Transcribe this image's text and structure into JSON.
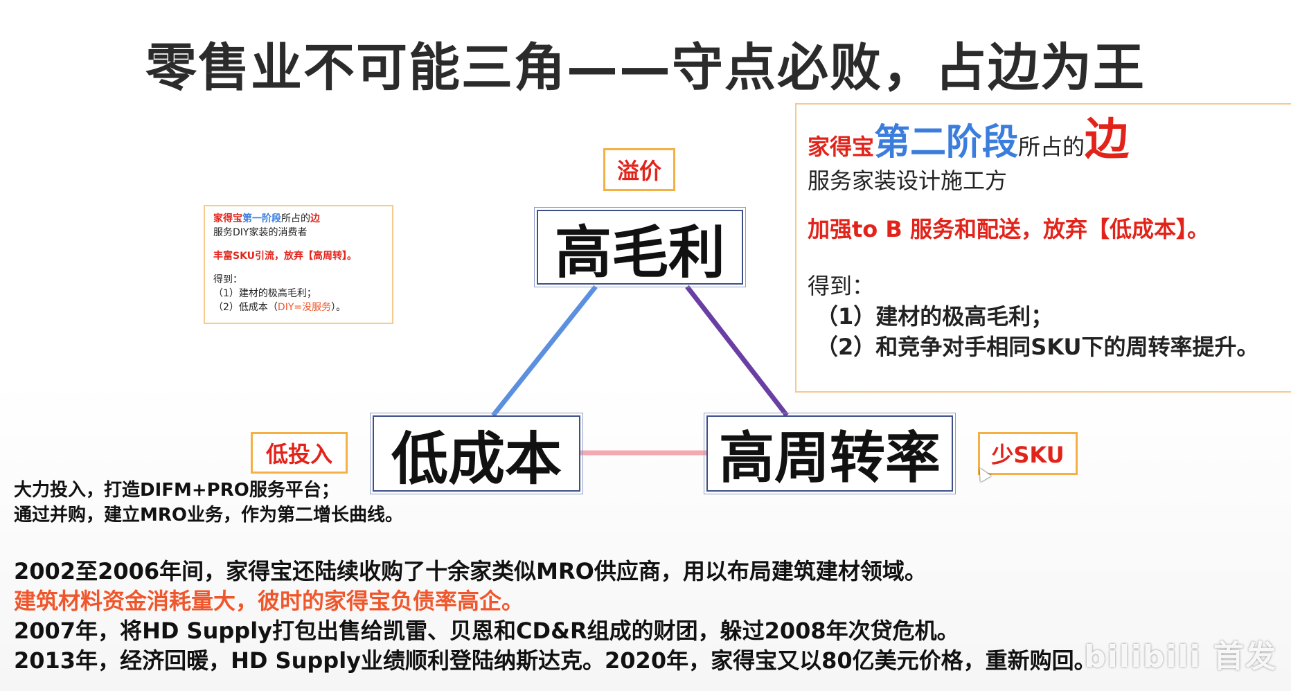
{
  "slide": {
    "title": "零售业不可能三角——守点必败，占边为王",
    "nodes": {
      "top": "高毛利",
      "left": "低成本",
      "right": "高周转率"
    },
    "tags": {
      "premium": "溢价",
      "low_investment": "低投入",
      "less_sku": "少SKU"
    },
    "colors": {
      "edge_top_left": "#5b8fe0",
      "edge_top_right": "#6a3fa3",
      "edge_left_right": "#f2a9b0"
    },
    "stage1_card": {
      "line1_a": "家得宝",
      "line1_b": "第一阶段",
      "line1_c": "所占的",
      "line1_d": "边",
      "line2": "服务DIY家装的消费者",
      "line3": "丰富SKU引流，放弃【高周转】。",
      "got_label": "得到：",
      "item1": "（1）建材的极高毛利；",
      "item2_a": "（2）低成本（",
      "item2_b": "DIY=没服务",
      "item2_c": "）。"
    },
    "stage2_card": {
      "head_a": "家得宝",
      "head_b": "第二阶段",
      "head_c": "所占的",
      "head_d": "边",
      "line2": "服务家装设计施工方",
      "line3": "加强to B 服务和配送，放弃【低成本】。",
      "got_label": "得到：",
      "item1": "（1）建材的极高毛利；",
      "item2": "（2）和竞争对手相同SKU下的周转率提升。"
    },
    "mid_text": {
      "line1": "大力投入，打造DIFM+PRO服务平台；",
      "line2": "通过并购，建立MRO业务，作为第二增长曲线。"
    },
    "bottom_text": {
      "line1": "2002至2006年间，家得宝还陆续收购了十余家类似MRO供应商，用以布局建筑建材领域。",
      "line2": "建筑材料资金消耗量大，彼时的家得宝负债率高企。",
      "line3": "2007年，将HD Supply打包出售给凯雷、贝恩和CD&R组成的财团，躲过2008年次贷危机。",
      "line4": "2013年，经济回暖，HD Supply业绩顺利登陆纳斯达克。2020年，家得宝又以80亿美元价格，重新购回。"
    },
    "watermark": "bilibili 首发"
  }
}
